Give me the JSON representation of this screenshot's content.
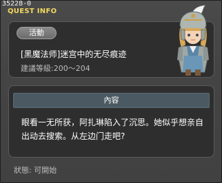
{
  "window": {
    "id_label": "35228-0",
    "title": "QUEST INFO"
  },
  "quest": {
    "category": "活動",
    "name": "[黑魔法师]迷宫中的无尽痕迹",
    "level_label": "建議等級:",
    "level_range": "200～204"
  },
  "npc": {
    "icon": "npc-portrait-helmeted-knight",
    "description": "helmeted knight with white plume"
  },
  "content": {
    "header": "內容",
    "text": "眼看一无所获，阿扎琳陷入了沉思。她似乎想亲自出动去搜索。从左边门走吧?"
  },
  "status": {
    "text": "狀態:  可開始"
  },
  "colors": {
    "title_yellow": "#f3d860",
    "panel_bg": "#2e2e2e",
    "header_bg": "#4b5a62"
  }
}
